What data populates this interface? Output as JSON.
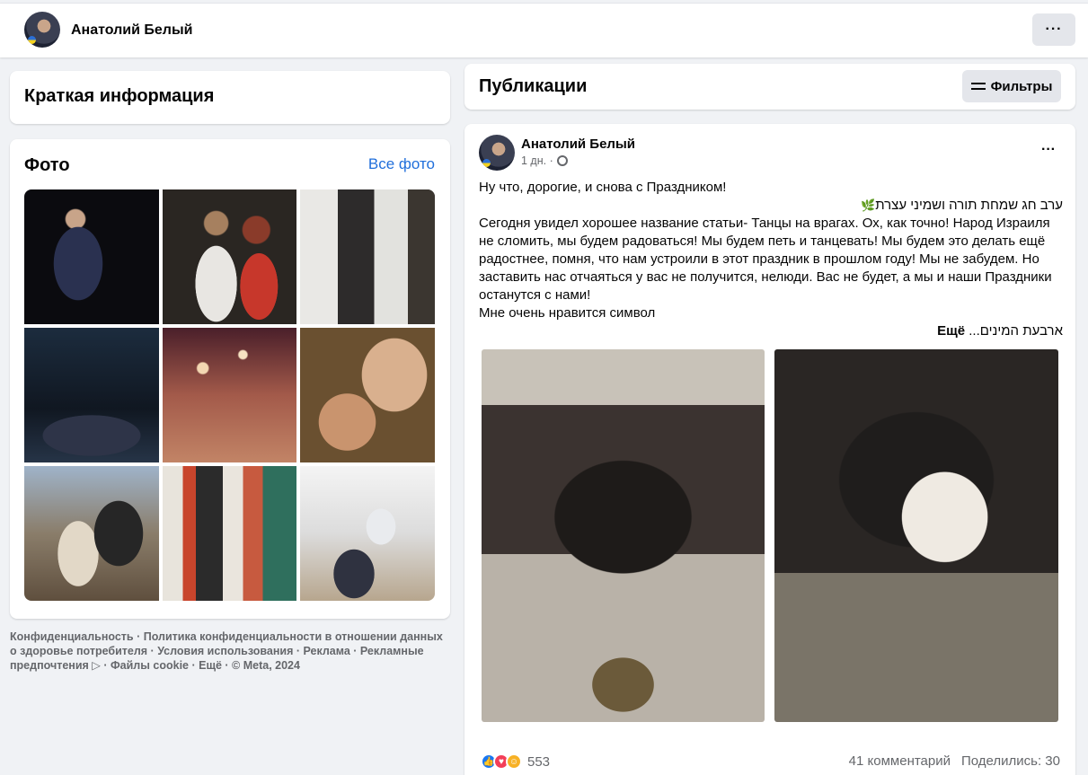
{
  "header": {
    "user_name": "Анатолий Белый",
    "more_label": "···"
  },
  "info": {
    "title": "Краткая информация"
  },
  "photos": {
    "title": "Фото",
    "all_link": "Все фото"
  },
  "footer": {
    "text": "Конфиденциальность · Политика конфиденциальности в отношении данных о здоровье потребителя · Условия использования · Реклама · Рекламные предпочтения ▷ · Файлы cookie · Ещё · © Meta, 2024"
  },
  "publications": {
    "title": "Публикации",
    "filters_label": "Фильтры"
  },
  "post": {
    "author": "Анатолий Белый",
    "time": "1 дн. ·",
    "more_label": "···",
    "line1": "Ну что, дорогие, и снова с Праздником!",
    "hebrew1": "ערב חג שמחת תורה ושמיני עצרת",
    "sprout": "🌿",
    "body": "Сегодня увидел хорошее название статьи- Танцы на врагах. Ох, как точно! Народ Израиля не сломить, мы будем радоваться! Мы будем петь и танцевать! Мы будем это делать ещё радостнее, помня, что нам устроили в этот праздник в прошлом году! Мы не забудем. Но заставить нас отчаяться у вас не получится, нелюди. Вас не будет, а мы и наши Праздники останутся с нами!",
    "line_symbol": "Мне очень нравится символ",
    "hebrew2": "ארבעת המינים...",
    "more_link": "Ещё",
    "reactions_count": "553",
    "comments": "41 комментарий",
    "shares": "Поделились: 30"
  },
  "colors": {
    "background": "#f0f2f5",
    "link": "#216fdb",
    "secondary_text": "#65676b"
  }
}
